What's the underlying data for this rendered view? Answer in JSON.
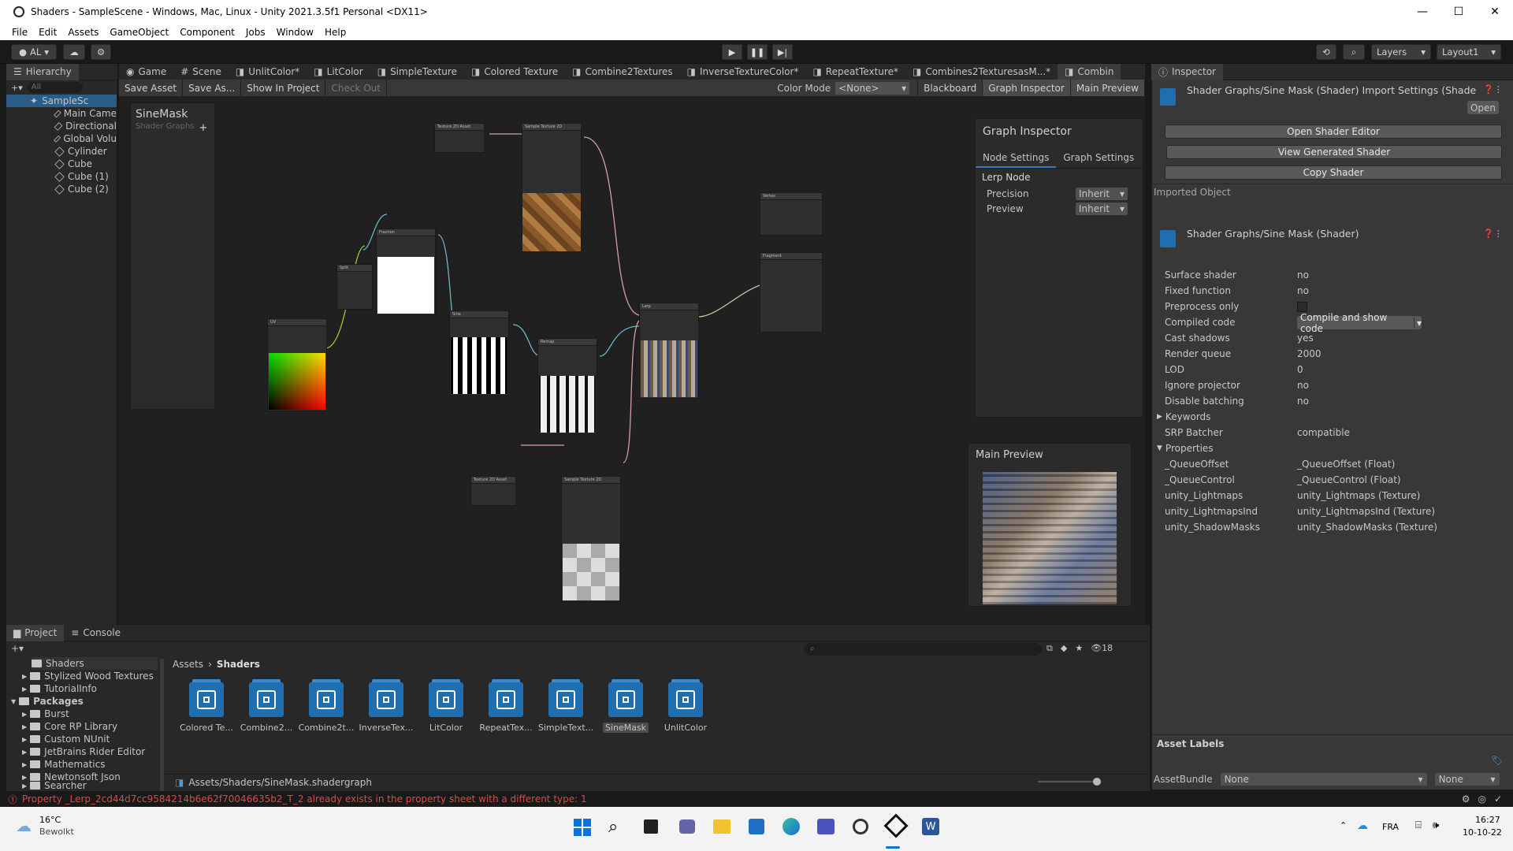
{
  "window": {
    "title": "Shaders - SampleScene - Windows, Mac, Linux - Unity 2021.3.5f1 Personal <DX11>"
  },
  "menu": [
    "File",
    "Edit",
    "Assets",
    "GameObject",
    "Component",
    "Jobs",
    "Window",
    "Help"
  ],
  "toolbar": {
    "account": "AL",
    "layers": "Layers",
    "layout": "Layout1"
  },
  "hierarchy": {
    "tab": "Hierarchy",
    "search_placeholder": "All",
    "scene": "SampleSc",
    "items": [
      "Main Came",
      "Directional",
      "Global Volu",
      "Cylinder",
      "Cube",
      "Cube (1)",
      "Cube (2)"
    ]
  },
  "center_tabs": [
    "Game",
    "Scene",
    "UnlitColor*",
    "LitColor",
    "SimpleTexture",
    "Colored Texture",
    "Combine2Textures",
    "InverseTextureColor*",
    "RepeatTexture*",
    "Combines2TexturesasM...*",
    "Combin"
  ],
  "shadergraph": {
    "save_asset": "Save Asset",
    "save_as": "Save As...",
    "show_in_project": "Show In Project",
    "check_out": "Check Out",
    "color_mode_label": "Color Mode",
    "color_mode_value": "<None>",
    "blackboard": "Blackboard",
    "graph_inspector": "Graph Inspector",
    "main_preview": "Main Preview",
    "blackboard_title": "SineMask",
    "blackboard_subtitle": "Shader Graphs"
  },
  "graph_inspector": {
    "title": "Graph Inspector",
    "tab_node": "Node Settings",
    "tab_graph": "Graph Settings",
    "node_name": "Lerp Node",
    "precision_label": "Precision",
    "precision_value": "Inherit",
    "preview_label": "Preview",
    "preview_value": "Inherit"
  },
  "main_preview": {
    "title": "Main Preview"
  },
  "inspector": {
    "tab": "Inspector",
    "header_title": "Shader Graphs/Sine Mask (Shader) Import Settings (Shade",
    "open": "Open",
    "open_editor": "Open Shader Editor",
    "view_generated": "View Generated Shader",
    "copy_shader": "Copy Shader",
    "imported_object": "Imported Object",
    "shader_name": "Shader Graphs/Sine Mask (Shader)",
    "props": [
      {
        "k": "Surface shader",
        "v": "no"
      },
      {
        "k": "Fixed function",
        "v": "no"
      },
      {
        "k": "Preprocess only",
        "v": ""
      },
      {
        "k": "Compiled code",
        "v": "Compile and show code"
      },
      {
        "k": "Cast shadows",
        "v": "yes"
      },
      {
        "k": "Render queue",
        "v": "2000"
      },
      {
        "k": "LOD",
        "v": "0"
      },
      {
        "k": "Ignore projector",
        "v": "no"
      },
      {
        "k": "Disable batching",
        "v": "no"
      }
    ],
    "keywords": "Keywords",
    "srp_label": "SRP Batcher",
    "srp_value": "compatible",
    "properties": "Properties",
    "plist": [
      {
        "k": "_QueueOffset",
        "v": "_QueueOffset (Float)"
      },
      {
        "k": "_QueueControl",
        "v": "_QueueControl (Float)"
      },
      {
        "k": "unity_Lightmaps",
        "v": "unity_Lightmaps (Texture)"
      },
      {
        "k": "unity_LightmapsInd",
        "v": "unity_LightmapsInd (Texture)"
      },
      {
        "k": "unity_ShadowMasks",
        "v": "unity_ShadowMasks (Texture)"
      }
    ],
    "asset_labels": "Asset Labels",
    "assetbundle_label": "AssetBundle",
    "assetbundle_value": "None",
    "variant_value": "None"
  },
  "project": {
    "tab": "Project",
    "console_tab": "Console",
    "hidden_count": "18",
    "breadcrumb_root": "Assets",
    "breadcrumb_current": "Shaders",
    "path": "Assets/Shaders/SineMask.shadergraph",
    "tree": [
      "Shaders",
      "Stylized Wood Textures",
      "TutorialInfo",
      "Packages",
      "Burst",
      "Core RP Library",
      "Custom NUnit",
      "JetBrains Rider Editor",
      "Mathematics",
      "Newtonsoft Json",
      "Searcher"
    ],
    "assets": [
      "Colored Te...",
      "Combine2...",
      "Combine2t...",
      "InverseTex...",
      "LitColor",
      "RepeatTex...",
      "SimpleText...",
      "SineMask",
      "UnlitColor"
    ]
  },
  "status": {
    "error": "Property _Lerp_2cd44d7cc9584214b6e62f70046635b2_T_2 already exists in the property sheet with a different type: 1"
  },
  "taskbar": {
    "temp": "16°C",
    "weather": "Bewolkt",
    "lang": "FRA",
    "time": "16:27",
    "date": "10-10-22"
  },
  "colors": {
    "accent": "#2c5d87",
    "error": "#d94a4a",
    "graph_bg": "#202020"
  }
}
